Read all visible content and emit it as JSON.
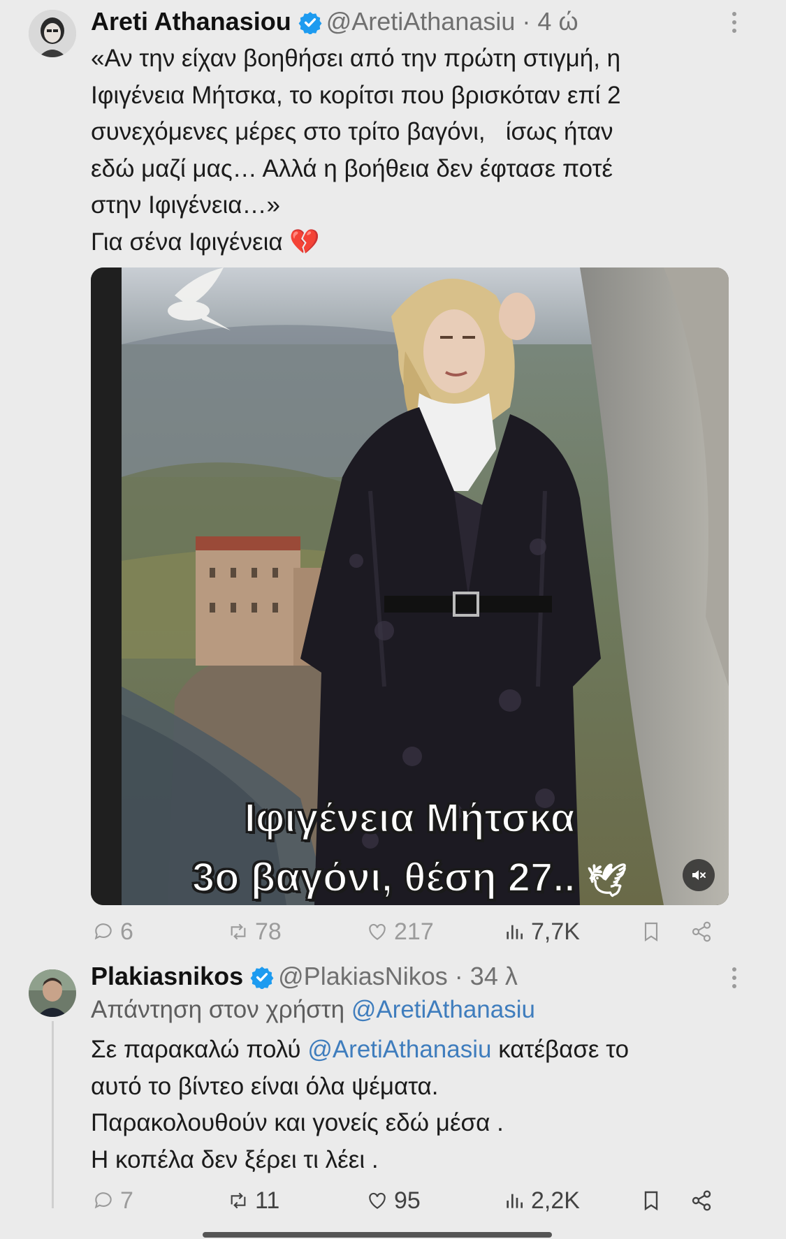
{
  "tweet1": {
    "display_name": "Areti Athanasiou",
    "handle": "@AretiAthanasiu",
    "separator": "·",
    "time": "4 ώ",
    "text_lines": [
      "«Αν την είχαν βοηθήσει από την πρώτη στιγμή, η",
      "Ιφιγένεια Μήτσκα, το κορίτσι που βρισκόταν επί 2",
      "συνεχόμενες μέρες στο τρίτο βαγόνι,   ίσως ήταν",
      "εδώ μαζί μας… Αλλά η βοήθεια δεν έφτασε ποτέ",
      "στην Ιφιγένεια…»"
    ],
    "dedication": "Για σένα Ιφιγένεια",
    "emoji": "💔",
    "video": {
      "caption_line1": "Ιφιγένεια Μήτσκα",
      "caption_line2": "3ο βαγόνι, θέση 27..",
      "caption_emoji": "🕊"
    },
    "stats": {
      "replies": "6",
      "retweets": "78",
      "likes": "217",
      "views": "7,7K"
    }
  },
  "tweet2": {
    "display_name": "Plakiasnikos",
    "handle": "@PlakiasNikos",
    "separator": "·",
    "time": "34 λ",
    "replying_to_label": "Απάντηση στον χρήστη",
    "replying_to_handle": "@AretiAthanasiu",
    "text_line1_before": "Σε παρακαλώ πολύ",
    "text_line1_mention": "@AretiAthanasiu",
    "text_line1_after": "κατέβασε το",
    "text_lines_rest": [
      "αυτό το βίντεο είναι όλα ψέματα.",
      "Παρακολουθούν και γονείς εδώ μέσα .",
      "Η κοπέλα δεν ξέρει τι λέει ."
    ],
    "stats": {
      "replies": "7",
      "retweets": "11",
      "likes": "95",
      "views": "2,2K"
    }
  },
  "colors": {
    "verified": "#1d9bf0",
    "mention": "#3f7dbd",
    "background": "#ebebeb"
  }
}
